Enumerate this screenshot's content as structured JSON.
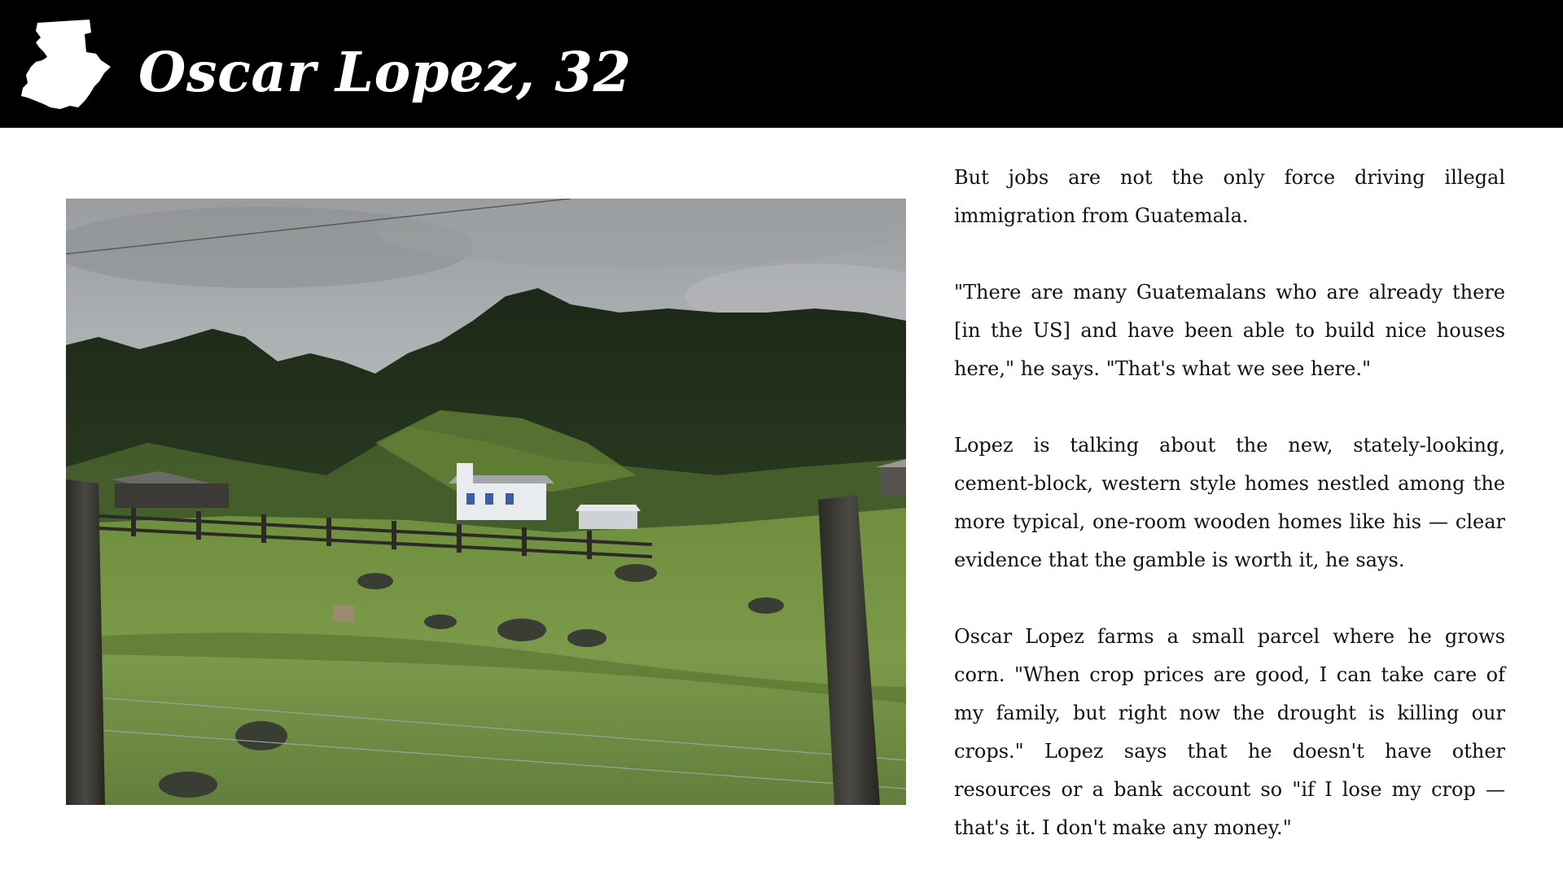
{
  "header": {
    "title": "Oscar Lopez, 32",
    "icon": "guatemala-map-icon",
    "background": "#000000"
  },
  "photo": {
    "subject": "green hillside pasture with fence posts, wire fence, and houses below a forested mountain under an overcast sky"
  },
  "article": {
    "paragraphs": [
      "But jobs are not the only force driving illegal immigration from Guatemala.",
      "\"There are many Guatemalans who are already there [in the US] and have been able to build nice houses here,\" he says. \"That's what we see here.\"",
      "Lopez is talking about the new, stately-looking, cement-block, western style homes nestled among the more typical, one-room wooden homes like his — clear evidence that the gamble is worth it, he says.",
      "Oscar Lopez farms a small parcel where he grows corn. \"When crop prices are good, I can take care of my family, but right now the drought is killing our crops.\" Lopez says that he doesn't have other resources or a bank account so \"if I lose my crop — that's it. I don't make any money.\""
    ]
  }
}
